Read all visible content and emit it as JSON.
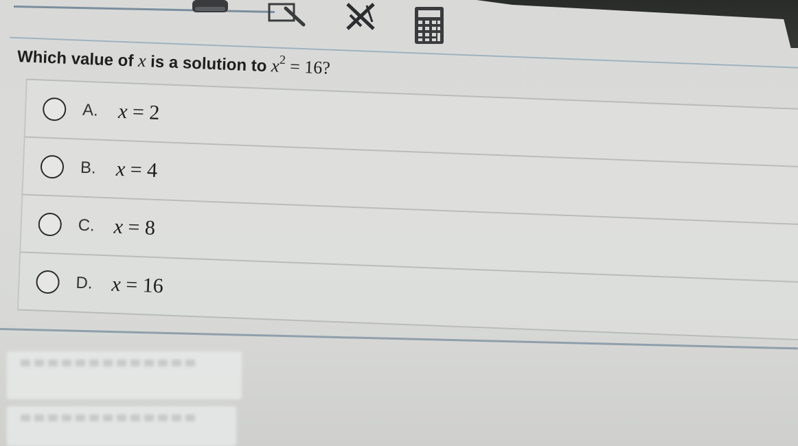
{
  "toolbar": {
    "tools": [
      {
        "name": "highlighter",
        "icon": "highlighter-icon"
      },
      {
        "name": "line-reader",
        "icon": "line-reader-icon"
      },
      {
        "name": "answer-eliminator",
        "icon": "eliminator-icon"
      },
      {
        "name": "calculator",
        "icon": "calculator-icon"
      }
    ]
  },
  "question": {
    "prefix": "Which value of ",
    "variable": "x",
    "middle": " is a solution to ",
    "expr_var": "x",
    "expr_exp": "2",
    "expr_rest": " = 16?"
  },
  "choices": [
    {
      "letter": "A.",
      "var": "x",
      "rest": " = 2"
    },
    {
      "letter": "B.",
      "var": "x",
      "rest": " = 4"
    },
    {
      "letter": "C.",
      "var": "x",
      "rest": " = 8"
    },
    {
      "letter": "D.",
      "var": "x",
      "rest": " = 16"
    }
  ],
  "colors": {
    "background": "#d8d9d7",
    "text": "#1f1f1f",
    "divider": "#b9bcbb",
    "accent_rule": "#9eb2c0"
  }
}
